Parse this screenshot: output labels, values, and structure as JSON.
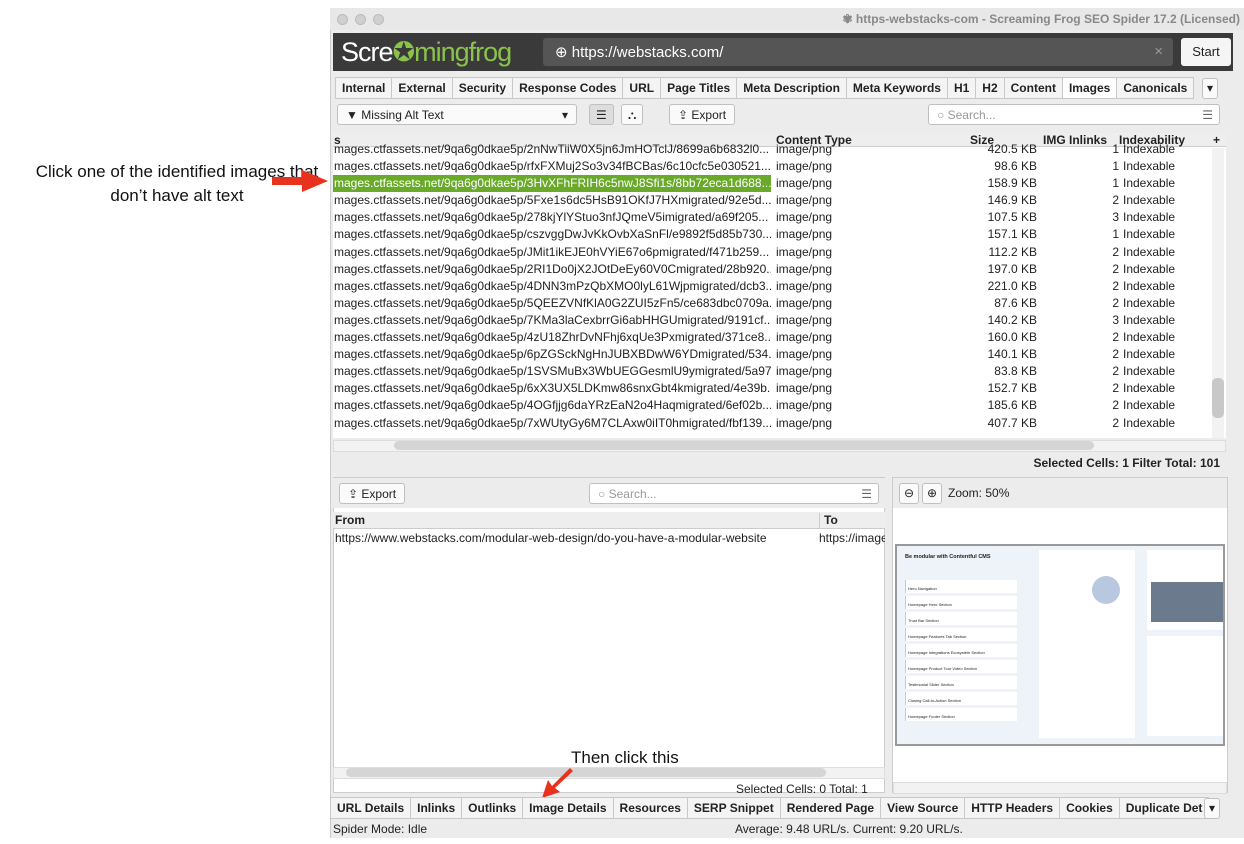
{
  "annotations": {
    "step1": "Click one of the identified images that don’t have alt text",
    "step2": "Then click this",
    "arrow_color": "#e8321e"
  },
  "window": {
    "title": "https-webstacks-com - Screaming Frog SEO Spider 17.2 (Licensed)"
  },
  "logo": {
    "part1": "Scre",
    "part2": "mingfrog"
  },
  "url_bar": {
    "value": "https://webstacks.com/",
    "start_label": "Start"
  },
  "tabs": [
    "Internal",
    "External",
    "Security",
    "Response Codes",
    "URL",
    "Page Titles",
    "Meta Description",
    "Meta Keywords",
    "H1",
    "H2",
    "Content",
    "Images",
    "Canonicals"
  ],
  "active_tab": "Images",
  "toolbar": {
    "filter": "Missing Alt Text",
    "export": "Export",
    "search_placeholder": "Search..."
  },
  "table": {
    "columns": [
      "s",
      "Content Type",
      "Size",
      "IMG Inlinks",
      "Indexability"
    ],
    "rows": [
      [
        "mages.ctfassets.net/9qa6g0dkae5p/2nNwTiiW0X5jn6JmHOTclJ/8699a6b6832l0...",
        "image/png",
        "420.5 KB",
        "1",
        "Indexable"
      ],
      [
        "mages.ctfassets.net/9qa6g0dkae5p/rfxFXMuj2So3v34fBCBas/6c10cfc5e030521...",
        "image/png",
        "98.6 KB",
        "1",
        "Indexable"
      ],
      [
        "mages.ctfassets.net/9qa6g0dkae5p/3HvXFhFRIH6c5nwJ8Sfi1s/8bb72eca1d688...",
        "image/png",
        "158.9 KB",
        "1",
        "Indexable"
      ],
      [
        "mages.ctfassets.net/9qa6g0dkae5p/5Fxe1s6dc5HsB91OKfJ7HXmigrated/92e5d...",
        "image/png",
        "146.9 KB",
        "2",
        "Indexable"
      ],
      [
        "mages.ctfassets.net/9qa6g0dkae5p/278kjYlYStuo3nfJQmeV5imigrated/a69f205...",
        "image/png",
        "107.5 KB",
        "3",
        "Indexable"
      ],
      [
        "mages.ctfassets.net/9qa6g0dkae5p/cszvggDwJvKkOvbXaSnFl/e9892f5d85b730...",
        "image/png",
        "157.1 KB",
        "1",
        "Indexable"
      ],
      [
        "mages.ctfassets.net/9qa6g0dkae5p/JMit1ikEJE0hVYiE67o6pmigrated/f471b259...",
        "image/png",
        "112.2 KB",
        "2",
        "Indexable"
      ],
      [
        "mages.ctfassets.net/9qa6g0dkae5p/2RI1Do0jX2JOtDeEy60V0Cmigrated/28b920...",
        "image/png",
        "197.0 KB",
        "2",
        "Indexable"
      ],
      [
        "mages.ctfassets.net/9qa6g0dkae5p/4DNN3mPzQbXMO0lyL61Wjpmigrated/dcb3...",
        "image/png",
        "221.0 KB",
        "2",
        "Indexable"
      ],
      [
        "mages.ctfassets.net/9qa6g0dkae5p/5QEEZVNfKlA0G2ZUI5zFn5/ce683dbc0709a...",
        "image/png",
        "87.6 KB",
        "2",
        "Indexable"
      ],
      [
        "mages.ctfassets.net/9qa6g0dkae5p/7KMa3laCexbrrGi6abHHGUmigrated/9191cf...",
        "image/png",
        "140.2 KB",
        "3",
        "Indexable"
      ],
      [
        "mages.ctfassets.net/9qa6g0dkae5p/4zU18ZhrDvNFhj6xqUe3Pxmigrated/371ce8...",
        "image/png",
        "160.0 KB",
        "2",
        "Indexable"
      ],
      [
        "mages.ctfassets.net/9qa6g0dkae5p/6pZGSckNgHnJUBXBDwW6YDmigrated/534...",
        "image/png",
        "140.1 KB",
        "2",
        "Indexable"
      ],
      [
        "mages.ctfassets.net/9qa6g0dkae5p/1SVSMuBx3WbUEGGesmlU9ymigrated/5a97...",
        "image/png",
        "83.8 KB",
        "2",
        "Indexable"
      ],
      [
        "mages.ctfassets.net/9qa6g0dkae5p/6xX3UX5LDKmw86snxGbt4kmigrated/4e39b...",
        "image/png",
        "152.7 KB",
        "2",
        "Indexable"
      ],
      [
        "mages.ctfassets.net/9qa6g0dkae5p/4OGfjjg6daYRzEaN2o4Haqmigrated/6ef02b...",
        "image/png",
        "185.6 KB",
        "2",
        "Indexable"
      ],
      [
        "mages.ctfassets.net/9qa6g0dkae5p/7xWUtyGy6M7CLAxw0iIT0hmigrated/fbf139...",
        "image/png",
        "407.7 KB",
        "2",
        "Indexable"
      ]
    ],
    "selected_index": 2,
    "status": "Selected Cells: 1  Filter Total: 101"
  },
  "lower": {
    "export": "Export",
    "search_placeholder": "Search...",
    "columns": [
      "From",
      "To"
    ],
    "rows": [
      [
        "https://www.webstacks.com/modular-web-design/do-you-have-a-modular-website",
        "https://image"
      ]
    ],
    "status": "Selected Cells: 0  Total: 1",
    "zoom_label": "Zoom: 50%",
    "preview": {
      "heading": "Be modular with Contentful CMS",
      "items": [
        "Hero Navigation",
        "Homepage Hero Section",
        "Trust Bar Section",
        "Homepage Features Tab Section",
        "Homepage Integrations Ecosystem Section",
        "Homepage Product Tour Video Section",
        "Testimonial Slider Section",
        "Closing Call-to-Action Section",
        "Homepage Footer Section"
      ]
    }
  },
  "bottom_tabs": [
    "URL Details",
    "Inlinks",
    "Outlinks",
    "Image Details",
    "Resources",
    "SERP Snippet",
    "Rendered Page",
    "View Source",
    "HTTP Headers",
    "Cookies",
    "Duplicate Det"
  ],
  "status_bar": {
    "mode": "Spider Mode: Idle",
    "speed": "Average: 9.48 URL/s. Current: 9.20 URL/s."
  }
}
